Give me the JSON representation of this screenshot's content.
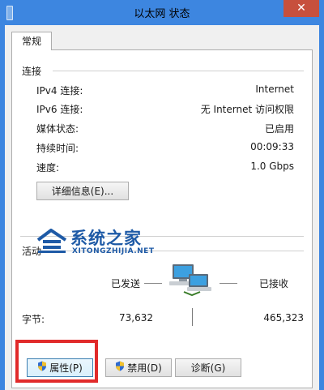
{
  "window": {
    "title": "以太网 状态",
    "close_glyph": "✕"
  },
  "tabs": [
    {
      "label": "常规"
    }
  ],
  "connection": {
    "heading": "连接",
    "rows": [
      {
        "label": "IPv4 连接:",
        "value": "Internet"
      },
      {
        "label": "IPv6 连接:",
        "value": "无 Internet 访问权限"
      },
      {
        "label": "媒体状态:",
        "value": "已启用"
      },
      {
        "label": "持续时间:",
        "value": "00:09:33"
      },
      {
        "label": "速度:",
        "value": "1.0 Gbps"
      }
    ],
    "details_button": "详细信息(E)..."
  },
  "activity": {
    "heading": "活动",
    "sent_label": "已发送",
    "received_label": "已接收",
    "bytes_label": "字节:",
    "bytes_sent": "73,632",
    "bytes_received": "465,323"
  },
  "buttons": {
    "properties": "属性(P)",
    "disable": "禁用(D)",
    "diagnose": "诊断(G)"
  },
  "watermark": {
    "brand": "系统之家",
    "sub": "XITONGZHIJIA.NET"
  },
  "colors": {
    "titlebar": "#3d86e0",
    "close": "#c7503d",
    "highlight": "#e12a2a",
    "watermark": "#1e5aa6"
  },
  "icons": {
    "network": "network-computers-icon",
    "shield": "uac-shield-icon"
  }
}
